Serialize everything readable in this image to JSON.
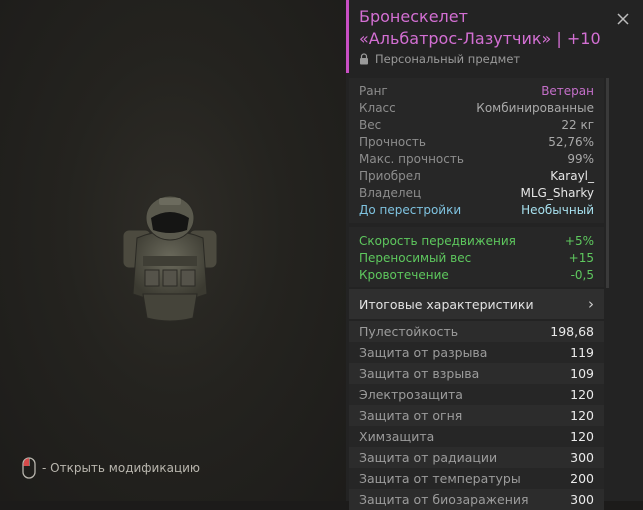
{
  "item": {
    "title_line1": "Бронескелет",
    "title_line2": "«Альбатрос-Лазутчик» | +10",
    "personal_label": "Персональный предмет"
  },
  "info": [
    {
      "label": "Ранг",
      "value": "Ветеран",
      "kind": "rank"
    },
    {
      "label": "Класс",
      "value": "Комбинированные",
      "kind": ""
    },
    {
      "label": "Вес",
      "value": "22 кг",
      "kind": ""
    },
    {
      "label": "Прочность",
      "value": "52,76%",
      "kind": ""
    },
    {
      "label": "Макс. прочность",
      "value": "99%",
      "kind": ""
    },
    {
      "label": "Приобрел",
      "value": "Karayl_",
      "kind": "white"
    },
    {
      "label": "Владелец",
      "value": "MLG_Sharky",
      "kind": "white"
    },
    {
      "label": "До перестройки",
      "value": "Необычный",
      "kind": "rebuild"
    }
  ],
  "bonuses": [
    {
      "label": "Скорость передвижения",
      "value": "+5%"
    },
    {
      "label": "Переносимый вес",
      "value": "+15"
    },
    {
      "label": "Кровотечение",
      "value": "-0,5"
    }
  ],
  "summary_label": "Итоговые характеристики",
  "summary_chevron": "›",
  "stats": [
    {
      "label": "Пулестойкость",
      "value": "198,68"
    },
    {
      "label": "Защита от разрыва",
      "value": "119"
    },
    {
      "label": "Защита от взрыва",
      "value": "109"
    },
    {
      "label": "Электрозащита",
      "value": "120"
    },
    {
      "label": "Защита от огня",
      "value": "120"
    },
    {
      "label": "Химзащита",
      "value": "120"
    },
    {
      "label": "Защита от радиации",
      "value": "300"
    },
    {
      "label": "Защита от температуры",
      "value": "200"
    },
    {
      "label": "Защита от биозаражения",
      "value": "300"
    }
  ],
  "hint": {
    "text": "- Открыть модификацию",
    "icon": "mouse-icon"
  },
  "colors": {
    "accent": "#c94fc4",
    "title": "#d36fd3",
    "green": "#5ec85e",
    "rebuild": "#7fc3e0"
  }
}
